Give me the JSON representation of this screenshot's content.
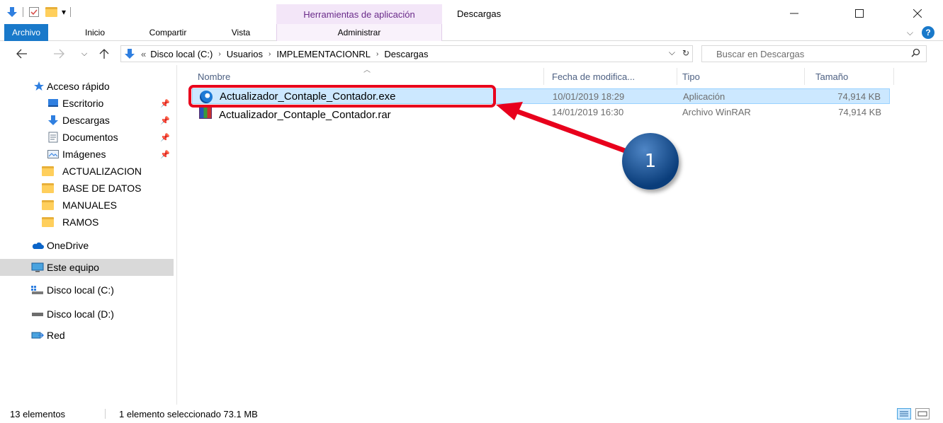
{
  "titlebar": {
    "context_tab_header": "Herramientas de aplicación",
    "window_title": "Descargas"
  },
  "ribbon": {
    "tabs": [
      {
        "label": "Archivo"
      },
      {
        "label": "Inicio"
      },
      {
        "label": "Compartir"
      },
      {
        "label": "Vista"
      },
      {
        "label": "Administrar"
      }
    ]
  },
  "address": {
    "overflow": "«",
    "crumbs": [
      "Disco local (C:)",
      "Usuarios",
      "IMPLEMENTACIONRL",
      "Descargas"
    ]
  },
  "search": {
    "placeholder": "Buscar en Descargas"
  },
  "navpane": {
    "items": [
      {
        "label": "Acceso rápido",
        "icon": "star-icon"
      },
      {
        "label": "Escritorio",
        "icon": "desktop-icon",
        "pinned": true
      },
      {
        "label": "Descargas",
        "icon": "download-icon",
        "pinned": true
      },
      {
        "label": "Documentos",
        "icon": "documents-icon",
        "pinned": true
      },
      {
        "label": "Imágenes",
        "icon": "pictures-icon",
        "pinned": true
      },
      {
        "label": "ACTUALIZACION",
        "icon": "folder-icon"
      },
      {
        "label": "BASE DE DATOS",
        "icon": "folder-icon"
      },
      {
        "label": "MANUALES",
        "icon": "folder-icon"
      },
      {
        "label": "RAMOS",
        "icon": "folder-icon"
      },
      {
        "label": "OneDrive",
        "icon": "cloud-icon"
      },
      {
        "label": "Este equipo",
        "icon": "computer-icon"
      },
      {
        "label": "Disco local (C:)",
        "icon": "drive-icon"
      },
      {
        "label": "Disco local (D:)",
        "icon": "drive-icon"
      },
      {
        "label": "Red",
        "icon": "network-icon"
      }
    ]
  },
  "columns": {
    "name": "Nombre",
    "date": "Fecha de modifica...",
    "type": "Tipo",
    "size": "Tamaño"
  },
  "files": [
    {
      "name": "Actualizador_Contaple_Contador.exe",
      "date": "10/01/2019 18:29",
      "type": "Aplicación",
      "size": "74,914 KB",
      "icon": "application-icon"
    },
    {
      "name": "Actualizador_Contaple_Contador.rar",
      "date": "14/01/2019 16:30",
      "type": "Archivo WinRAR",
      "size": "74,914 KB",
      "icon": "winrar-icon"
    }
  ],
  "annotation": {
    "badge": "1",
    "color": "#e8001c"
  },
  "status": {
    "count": "13 elementos",
    "selection": "1 elemento seleccionado  73.1 MB"
  },
  "colors": {
    "accent": "#1979ca",
    "selection": "#cce8ff",
    "context_tab": "#f3e6f8"
  }
}
